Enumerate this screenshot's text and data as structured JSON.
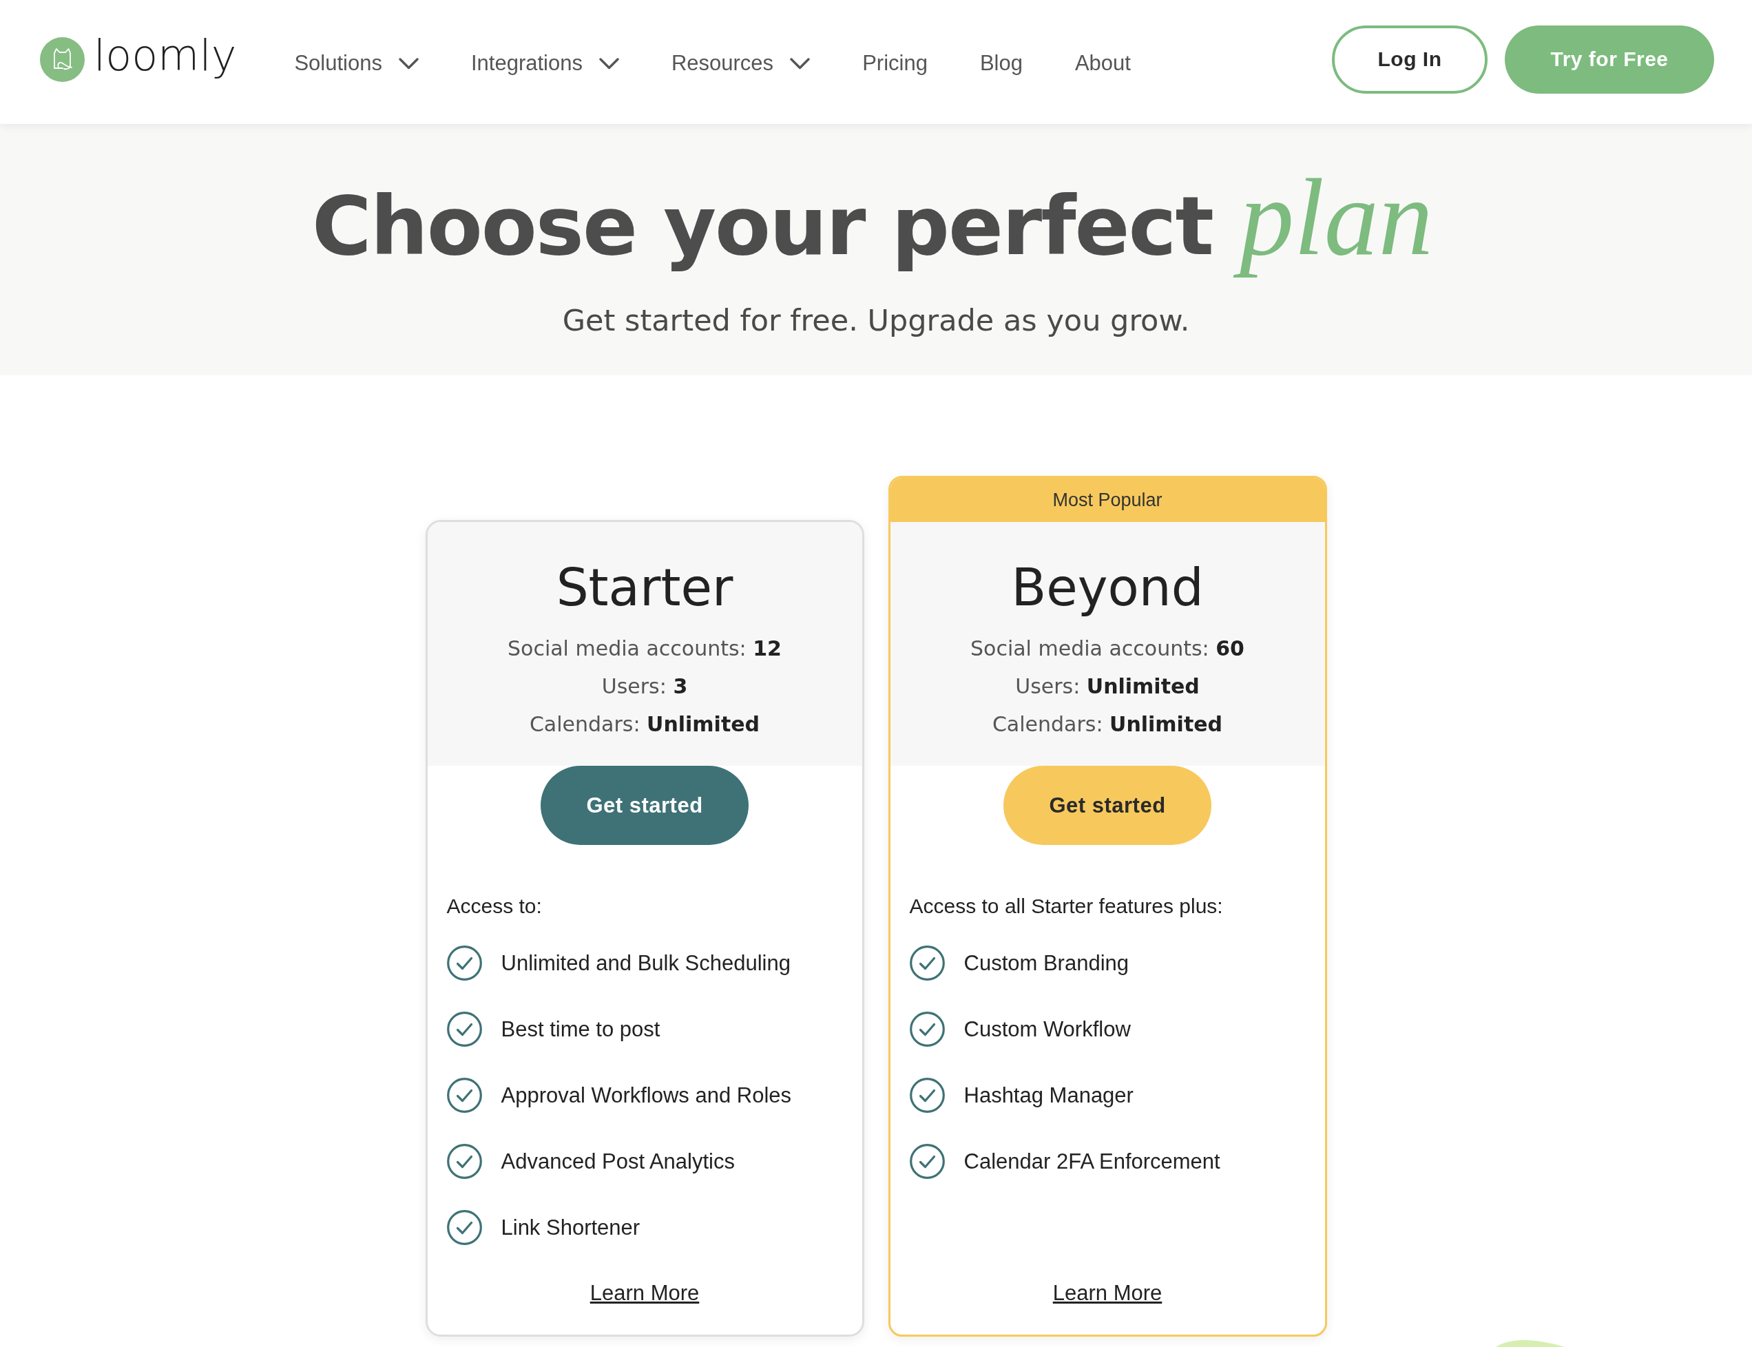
{
  "header": {
    "logo": "loomly",
    "nav": [
      {
        "label": "Solutions",
        "dropdown": true
      },
      {
        "label": "Integrations",
        "dropdown": true
      },
      {
        "label": "Resources",
        "dropdown": true
      },
      {
        "label": "Pricing",
        "dropdown": false
      },
      {
        "label": "Blog",
        "dropdown": false
      },
      {
        "label": "About",
        "dropdown": false
      }
    ],
    "actions": [
      {
        "label": "Log In",
        "kind": "login"
      },
      {
        "label": "Try for Free",
        "kind": "signup"
      }
    ]
  },
  "hero": {
    "title": "Choose your perfect *plan*",
    "subtitle": "Get started for free. Upgrade as you grow."
  },
  "plans": [
    {
      "name": "Starter",
      "featured": false,
      "stats": [
        "Social media accounts: **12**",
        "Users: **3**",
        "Calendars: **Unlimited**"
      ],
      "button": "Get started",
      "features_heading": "Access to:",
      "features": [
        "Unlimited and Bulk Scheduling",
        "Best time to post",
        "Approval Workflows and Roles",
        "Advanced Post Analytics",
        "Link Shortener"
      ],
      "link": "Learn More"
    },
    {
      "name": "Beyond",
      "featured": true,
      "badge": "Most Popular",
      "stats": [
        "Social media accounts: **60**",
        "Users: **Unlimited**",
        "Calendars: **Unlimited**"
      ],
      "button": "Get started",
      "features_heading": "Access to all Starter features plus:",
      "features": [
        "Custom Branding",
        "Custom Workflow",
        "Hashtag Manager",
        "Calendar 2FA Enforcement"
      ],
      "link": "Learn More"
    }
  ]
}
